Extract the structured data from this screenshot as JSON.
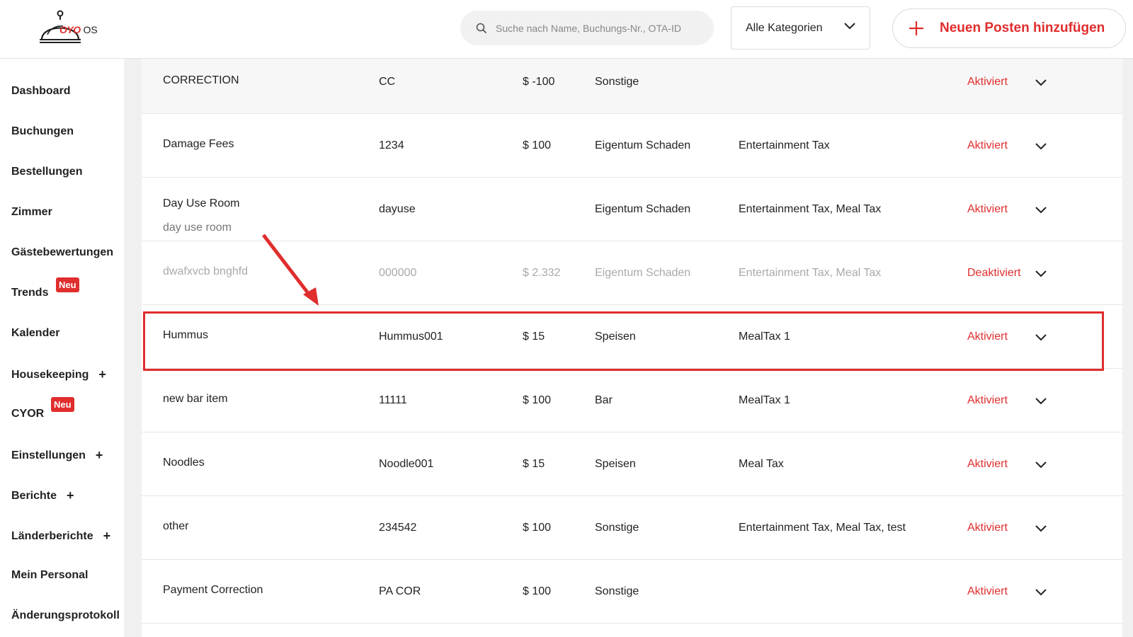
{
  "header": {
    "logo": {
      "brand": "OYO",
      "suffix": "OS"
    },
    "search_placeholder": "Suche nach Name, Buchungs-Nr., OTA-ID",
    "category_label": "Alle Kategorien",
    "add_button_label": "Neuen Posten hinzufügen"
  },
  "sidebar": {
    "items": [
      {
        "label": "Dashboard"
      },
      {
        "label": "Buchungen"
      },
      {
        "label": "Bestellungen"
      },
      {
        "label": "Zimmer"
      },
      {
        "label": "Gästebewertungen"
      },
      {
        "label": "Trends",
        "badge": "Neu"
      },
      {
        "label": "Kalender"
      },
      {
        "label": "Housekeeping",
        "expand": "+"
      },
      {
        "label": "CYOR",
        "badge": "Neu"
      },
      {
        "label": "Einstellungen",
        "expand": "+"
      },
      {
        "label": "Berichte",
        "expand": "+"
      },
      {
        "label": "Länderberichte",
        "expand": "+"
      },
      {
        "label": "Mein Personal"
      },
      {
        "label": "Änderungsprotokoll"
      }
    ]
  },
  "table": {
    "rows": [
      {
        "name": "CORRECTION",
        "sub": "",
        "code": "CC",
        "price": "$ -100",
        "category": "Sonstige",
        "tax": "",
        "status": "Aktiviert"
      },
      {
        "name": "Damage Fees",
        "sub": "",
        "code": "1234",
        "price": "$ 100",
        "category": "Eigentum Schaden",
        "tax": "Entertainment Tax",
        "status": "Aktiviert"
      },
      {
        "name": "Day Use Room",
        "sub": "day use room",
        "code": "dayuse",
        "price": "",
        "category": "Eigentum Schaden",
        "tax": "Entertainment Tax, Meal Tax",
        "status": "Aktiviert"
      },
      {
        "name": "dwafxvcb bnghfd",
        "sub": "",
        "code": "000000",
        "price": "$ 2.332",
        "category": "Eigentum Schaden",
        "tax": "Entertainment Tax, Meal Tax",
        "status": "Deaktiviert"
      },
      {
        "name": "Hummus",
        "sub": "",
        "code": "Hummus001",
        "price": "$ 15",
        "category": "Speisen",
        "tax": "MealTax 1",
        "status": "Aktiviert"
      },
      {
        "name": "new bar item",
        "sub": "",
        "code": "11111",
        "price": "$ 100",
        "category": "Bar",
        "tax": "MealTax 1",
        "status": "Aktiviert"
      },
      {
        "name": "Noodles",
        "sub": "",
        "code": "Noodle001",
        "price": "$ 15",
        "category": "Speisen",
        "tax": "Meal Tax",
        "status": "Aktiviert"
      },
      {
        "name": "other",
        "sub": "",
        "code": "234542",
        "price": "$ 100",
        "category": "Sonstige",
        "tax": "Entertainment Tax, Meal Tax, test",
        "status": "Aktiviert"
      },
      {
        "name": "Payment Correction",
        "sub": "",
        "code": "PA COR",
        "price": "$ 100",
        "category": "Sonstige",
        "tax": "",
        "status": "Aktiviert"
      }
    ]
  },
  "colors": {
    "accent": "#e02d2d",
    "disabled_text": "#a9a9a9"
  },
  "icons": {
    "search": "search-icon",
    "dropdown": "chevron-down-icon",
    "add": "plus-icon"
  }
}
